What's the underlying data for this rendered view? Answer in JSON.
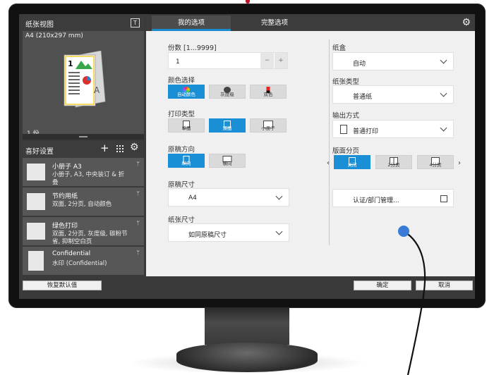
{
  "left_panel": {
    "paper_view_title": "纸张视图",
    "paper_size": "A4 (210x297 mm)",
    "copy_count": "1 份",
    "favorites_title": "喜好设置",
    "favorites": [
      {
        "name": "小册子 A3",
        "desc": "小册子, A3, 中央装订 & 折叠"
      },
      {
        "name": "节约用纸",
        "desc": "双面, 2分页, 自动颜色"
      },
      {
        "name": "绿色打印",
        "desc": "双面, 2分页, 灰度级, 碳粉节省, 抑制空白页"
      },
      {
        "name": "Confidential",
        "desc": "水印 (Confidential)"
      }
    ]
  },
  "tabs": [
    {
      "label": "我的选项",
      "active": true
    },
    {
      "label": "完整选项",
      "active": false
    }
  ],
  "copies": {
    "label": "份数 [1...9999]",
    "value": "1",
    "minus": "−",
    "plus": "+"
  },
  "color": {
    "label": "颜色选择",
    "options": [
      {
        "label": "自动颜色",
        "selected": true
      },
      {
        "label": "灰度级",
        "selected": false
      },
      {
        "label": "双色",
        "selected": false
      }
    ]
  },
  "print_type": {
    "label": "打印类型",
    "options": [
      {
        "label": "单面",
        "selected": false
      },
      {
        "label": "双面",
        "selected": true
      },
      {
        "label": "小册子",
        "selected": false
      }
    ]
  },
  "orientation": {
    "label": "原稿方向",
    "options": [
      {
        "label": "纵向",
        "selected": true
      },
      {
        "label": "横向",
        "selected": false
      }
    ]
  },
  "original_size": {
    "label": "原稿尺寸",
    "value": "A4"
  },
  "paper_size": {
    "label": "纸张尺寸",
    "value": "如同原稿尺寸"
  },
  "tray": {
    "label": "纸盒",
    "value": "自动"
  },
  "paper_type": {
    "label": "纸张类型",
    "value": "普通纸"
  },
  "output": {
    "label": "输出方式",
    "value": "普通打印"
  },
  "layout": {
    "label": "版面分页",
    "options": [
      {
        "label": "关闭",
        "selected": true
      },
      {
        "label": "2分页",
        "selected": false
      },
      {
        "label": "4分页",
        "selected": false
      }
    ]
  },
  "auth": {
    "label": "认证/部门管理..."
  },
  "bottom": {
    "restore": "恢复默认值",
    "ok": "确定",
    "cancel": "取消"
  },
  "colors": {
    "accent": "#1b8fd6",
    "pointer": "#3a7bd5"
  }
}
